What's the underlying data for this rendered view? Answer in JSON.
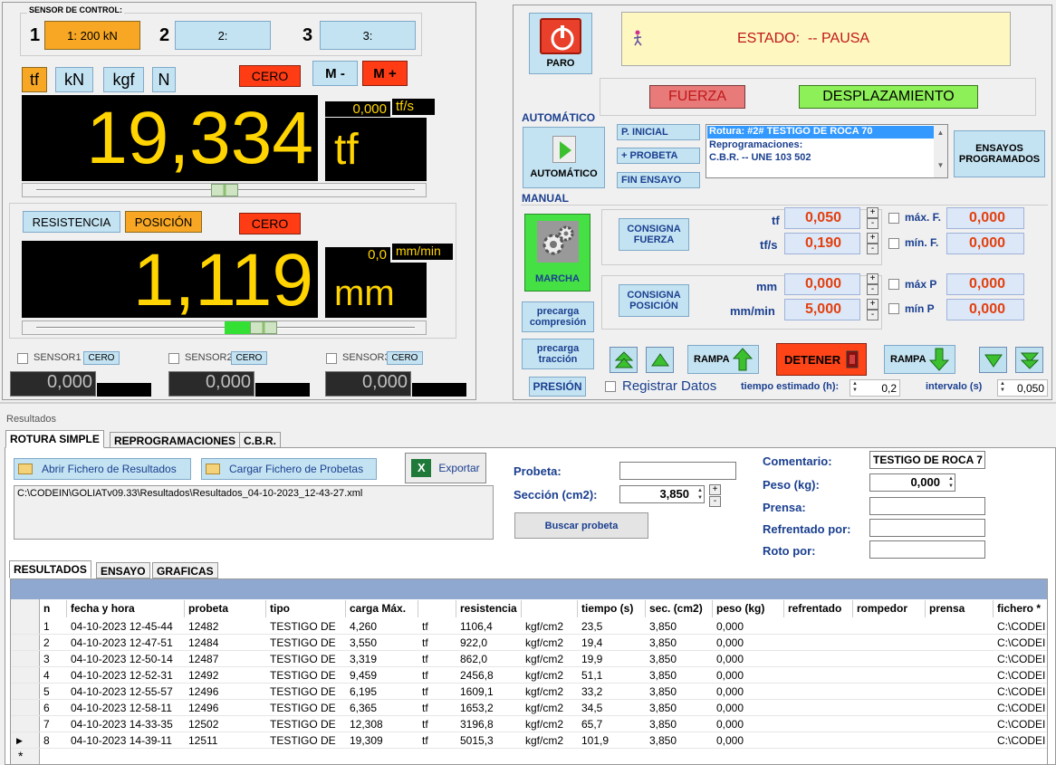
{
  "left": {
    "sensor_control_label": "SENSOR DE CONTROL:",
    "sensors": [
      {
        "num": "1",
        "label": "1: 200 kN"
      },
      {
        "num": "2",
        "label": "2:"
      },
      {
        "num": "3",
        "label": "3:"
      }
    ],
    "units": [
      "tf",
      "kN",
      "kgf",
      "N"
    ],
    "cero": "CERO",
    "m_minus": "M -",
    "m_plus": "M +",
    "force_value": "19,334",
    "force_unit": "tf",
    "force_rate": "0,000",
    "force_rate_unit": "tf/s",
    "resistencia": "RESISTENCIA",
    "posicion": "POSICIÓN",
    "pos_value": "1,119",
    "pos_unit": "mm",
    "pos_rate": "0,0",
    "pos_rate_unit": "mm/min",
    "aux": [
      {
        "label": "SENSOR1",
        "cero": "CERO",
        "value": "0,000"
      },
      {
        "label": "SENSOR2",
        "cero": "CERO",
        "value": "0,000"
      },
      {
        "label": "SENSOR3",
        "cero": "CERO",
        "value": "0,000"
      }
    ]
  },
  "right": {
    "paro": "PARO",
    "estado": "ESTADO:  -- PAUSA",
    "fuerza": "FUERZA",
    "desplazamiento": "DESPLAZAMIENTO",
    "automatico_title": "AUTOMÁTICO",
    "automatico_btn": "AUTOMÁTICO",
    "p_inicial": "P. INICIAL",
    "probeta": "+ PROBETA",
    "fin_ensayo": "FIN ENSAYO",
    "list": [
      "Rotura: #2# TESTIGO DE ROCA 70",
      "Reprogramaciones:",
      "C.B.R. -- UNE 103 502"
    ],
    "ensayos": "ENSAYOS PROGRAMADOS",
    "manual": "MANUAL",
    "marcha": "MARCHA",
    "consigna_fuerza": "CONSIGNA FUERZA",
    "consigna_posicion": "CONSIGNA POSICIÓN",
    "f_rows": [
      {
        "unit": "tf",
        "value": "0,050",
        "chk": "máx. F.",
        "lim": "0,000"
      },
      {
        "unit": "tf/s",
        "value": "0,190",
        "chk": "mín. F.",
        "lim": "0,000"
      }
    ],
    "p_rows": [
      {
        "unit": "mm",
        "value": "0,000",
        "chk": "máx P",
        "lim": "0,000"
      },
      {
        "unit": "mm/min",
        "value": "5,000",
        "chk": "mín P",
        "lim": "0,000"
      }
    ],
    "precarga_comp": "precarga compresión",
    "precarga_trac": "precarga tracción",
    "rampa": "RAMPA",
    "detener": "DETENER",
    "presion": "PRESIÓN",
    "registrar": "Registrar Datos",
    "tiempo_lbl": "tiempo estimado (h):",
    "tiempo_val": "0,2",
    "intervalo_lbl": "intervalo (s)",
    "intervalo_val": "0,050"
  },
  "results": {
    "title": "Resultados",
    "tabs": [
      "ROTURA SIMPLE",
      "REPROGRAMACIONES",
      "C.B.R."
    ],
    "abrir": "Abrir Fichero de Resultados",
    "cargar": "Cargar Fichero de Probetas",
    "exportar": "Exportar",
    "path": "C:\\CODEIN\\GOLIATv09.33\\Resultados\\Resultados_04-10-2023_12-43-27.xml",
    "probeta_lbl": "Probeta:",
    "seccion_lbl": "Sección (cm2):",
    "seccion_val": "3,850",
    "buscar": "Buscar probeta",
    "comentario_lbl": "Comentario:",
    "comentario_val": "TESTIGO DE ROCA 7",
    "peso_lbl": "Peso (kg):",
    "peso_val": "0,000",
    "prensa_lbl": "Prensa:",
    "refrentado_lbl": "Refrentado por:",
    "roto_lbl": "Roto por:",
    "subtabs": [
      "RESULTADOS",
      "ENSAYO",
      "GRAFICAS"
    ],
    "columns": [
      "n",
      "fecha y hora",
      "probeta",
      "tipo",
      "carga Máx.",
      "",
      "resistencia",
      "",
      "tiempo (s)",
      "sec. (cm2)",
      "peso (kg)",
      "refrentado",
      "rompedor",
      "prensa",
      "fichero *"
    ],
    "rows": [
      [
        "1",
        "04-10-2023  12-45-44",
        "12482",
        "TESTIGO DE",
        "4,260",
        "tf",
        "1106,4",
        "kgf/cm2",
        "23,5",
        "3,850",
        "0,000",
        "",
        "",
        "",
        "C:\\CODEI"
      ],
      [
        "2",
        "04-10-2023  12-47-51",
        "12484",
        "TESTIGO DE",
        "3,550",
        "tf",
        "922,0",
        "kgf/cm2",
        "19,4",
        "3,850",
        "0,000",
        "",
        "",
        "",
        "C:\\CODEI"
      ],
      [
        "3",
        "04-10-2023  12-50-14",
        "12487",
        "TESTIGO DE",
        "3,319",
        "tf",
        "862,0",
        "kgf/cm2",
        "19,9",
        "3,850",
        "0,000",
        "",
        "",
        "",
        "C:\\CODEI"
      ],
      [
        "4",
        "04-10-2023  12-52-31",
        "12492",
        "TESTIGO DE",
        "9,459",
        "tf",
        "2456,8",
        "kgf/cm2",
        "51,1",
        "3,850",
        "0,000",
        "",
        "",
        "",
        "C:\\CODEI"
      ],
      [
        "5",
        "04-10-2023  12-55-57",
        "12496",
        "TESTIGO DE",
        "6,195",
        "tf",
        "1609,1",
        "kgf/cm2",
        "33,2",
        "3,850",
        "0,000",
        "",
        "",
        "",
        "C:\\CODEI"
      ],
      [
        "6",
        "04-10-2023  12-58-11",
        "12496",
        "TESTIGO DE",
        "6,365",
        "tf",
        "1653,2",
        "kgf/cm2",
        "34,5",
        "3,850",
        "0,000",
        "",
        "",
        "",
        "C:\\CODEI"
      ],
      [
        "7",
        "04-10-2023  14-33-35",
        "12502",
        "TESTIGO DE",
        "12,308",
        "tf",
        "3196,8",
        "kgf/cm2",
        "65,7",
        "3,850",
        "0,000",
        "",
        "",
        "",
        "C:\\CODEI"
      ],
      [
        "8",
        "04-10-2023  14-39-11",
        "12511",
        "TESTIGO DE",
        "19,309",
        "tf",
        "5015,3",
        "kgf/cm2",
        "101,9",
        "3,850",
        "0,000",
        "",
        "",
        "",
        "C:\\CODEI"
      ]
    ],
    "new_row_marker": "*"
  }
}
